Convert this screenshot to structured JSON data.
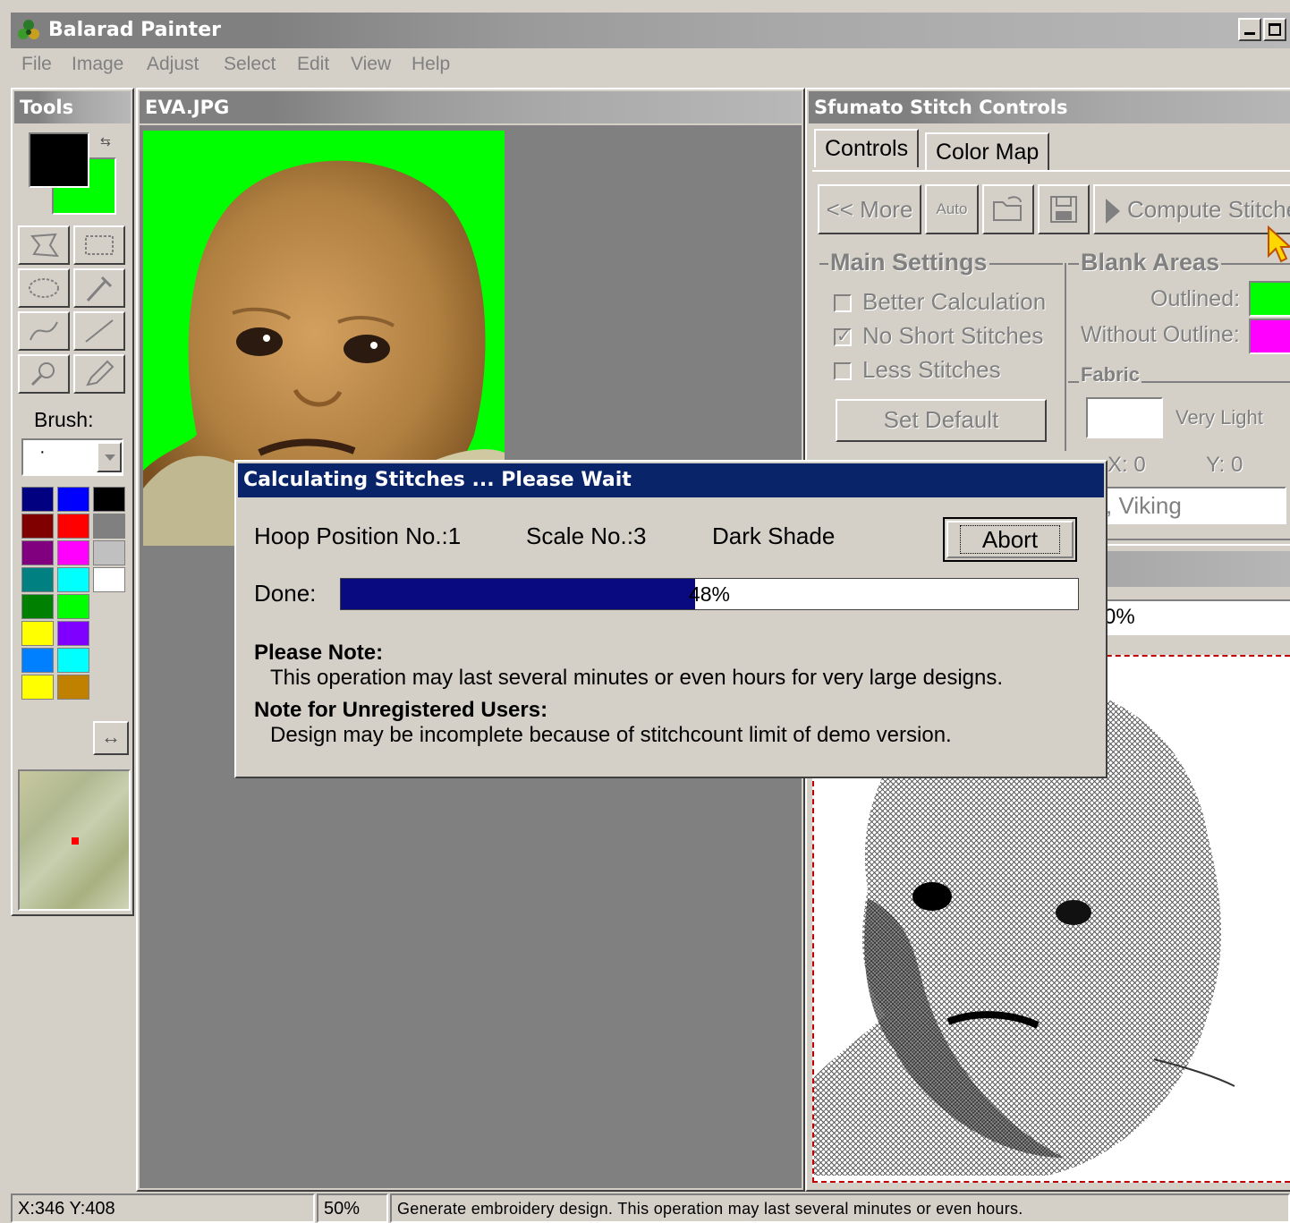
{
  "app": {
    "title": "Balarad Painter",
    "minimize_icon": "minimize-icon",
    "maximize_icon": "maximize-icon"
  },
  "menu": [
    "File",
    "Image",
    "Adjust",
    "Select",
    "Edit",
    "View",
    "Help"
  ],
  "tools": {
    "title": "Tools",
    "foreground_color": "#000000",
    "background_color": "#00ff00",
    "tool_icons": [
      "lasso-icon",
      "rect-select-icon",
      "ellipse-select-icon",
      "eyedropper-icon",
      "curve-icon",
      "line-icon",
      "zoom-icon",
      "pencil-icon"
    ],
    "brush_label": "Brush:",
    "brush_value": "·",
    "palette": [
      "#000080",
      "#0000ff",
      "#000000",
      "#800000",
      "#ff0000",
      "#808080",
      "#800080",
      "#ff00ff",
      "#c0c0c0",
      "#008080",
      "#00ffff",
      "#ffffff",
      "#008000",
      "#00ff00",
      "#808000",
      "#ffff00",
      "#8000ff",
      "#cc99ff",
      "#0080ff",
      "#00ffff",
      "#80c000",
      "#ffff00",
      "#c08000",
      "#ffff00"
    ],
    "swap_icon": "swap-arrows-icon"
  },
  "image_window": {
    "title": "EVA.JPG"
  },
  "sfumato": {
    "title": "Sfumato Stitch Controls",
    "tabs": [
      "Controls",
      "Color Map"
    ],
    "buttons": {
      "more": "<< More",
      "auto": "Auto",
      "compute": "Compute Stitche"
    },
    "main_settings": {
      "label": "Main Settings",
      "better_calculation": "Better Calculation",
      "no_short_stitches": "No Short Stitches",
      "less_stitches": "Less Stitches",
      "set_default": "Set Default"
    },
    "blank_areas": {
      "label": "Blank Areas",
      "outlined": "Outlined:",
      "outlined_color": "#00ff00",
      "without_outline": "Without Outline:",
      "without_outline_color": "#ff00ff"
    },
    "fabric": {
      "label": "Fabric",
      "shade": "Very Light",
      "x": "X:  0",
      "y": "Y:  0"
    },
    "machine": ", Viking",
    "zoom": "0%"
  },
  "dialog": {
    "title": "Calculating Stitches ... Please Wait",
    "hoop": "Hoop Position No.:1",
    "scale": "Scale No.:3",
    "shade": "Dark Shade",
    "abort": "Abort",
    "done_label": "Done:",
    "progress": 48,
    "progress_text": "48%",
    "note_heading": "Please Note:",
    "note_text": "This operation may last several minutes or even hours for very large designs.",
    "unreg_heading": "Note for Unregistered Users:",
    "unreg_text": "Design may be incomplete because of stitchcount limit of demo version."
  },
  "status": {
    "coords": "X:346   Y:408",
    "zoom": "50%",
    "message": "Generate embroidery design. This operation may last several minutes or even hours."
  }
}
